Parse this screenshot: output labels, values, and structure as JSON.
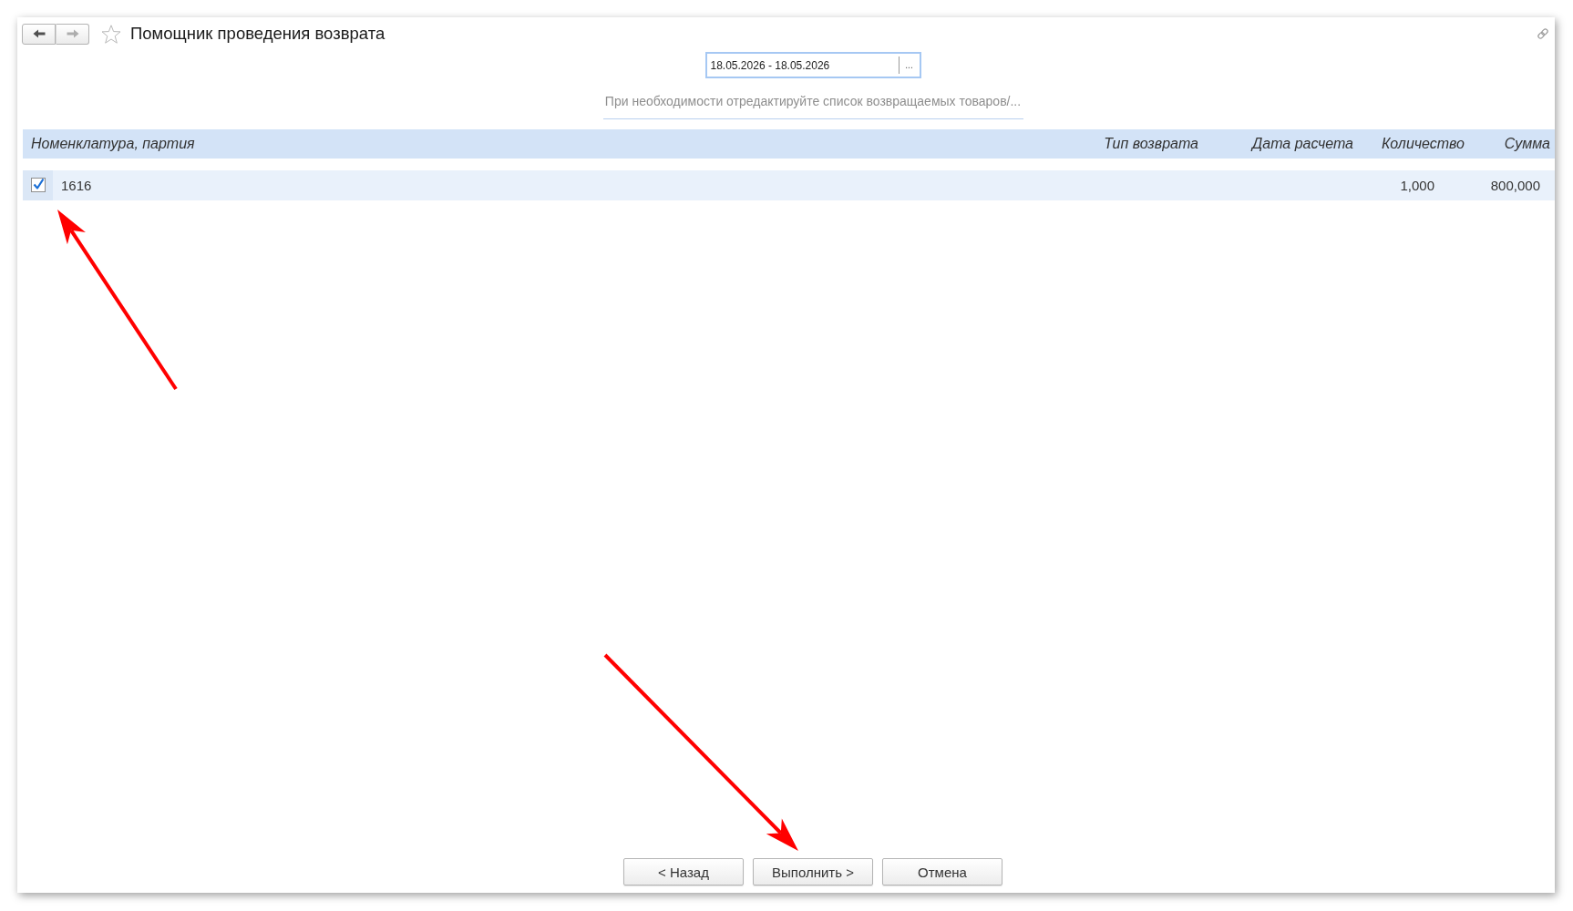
{
  "window": {
    "title": "Помощник проведения возврата",
    "favorite": false
  },
  "navigation": [
    {
      "kind": "back",
      "disabled": false
    },
    {
      "kind": "forward",
      "disabled": true
    }
  ],
  "period": {
    "value": "18.05.2026 - 18.05.2026",
    "focused": true,
    "button": "..."
  },
  "hint_link": "При необходимости отредактируйте список возвращаемых товаров/...",
  "table": {
    "columns": [
      "Номенклатура, партия",
      "Тип возврата",
      "Дата расчета",
      "Количество",
      "Сумма"
    ],
    "rows": [
      {
        "selected": true,
        "checked": true,
        "item": "1616",
        "quantity": "1,000",
        "sum": "800,000"
      }
    ]
  },
  "buttons": [
    "< Назад",
    "Выполнить >",
    "Отмена"
  ],
  "annotations": [
    {
      "kind": "arrow"
    },
    {
      "kind": "arrow"
    }
  ]
}
